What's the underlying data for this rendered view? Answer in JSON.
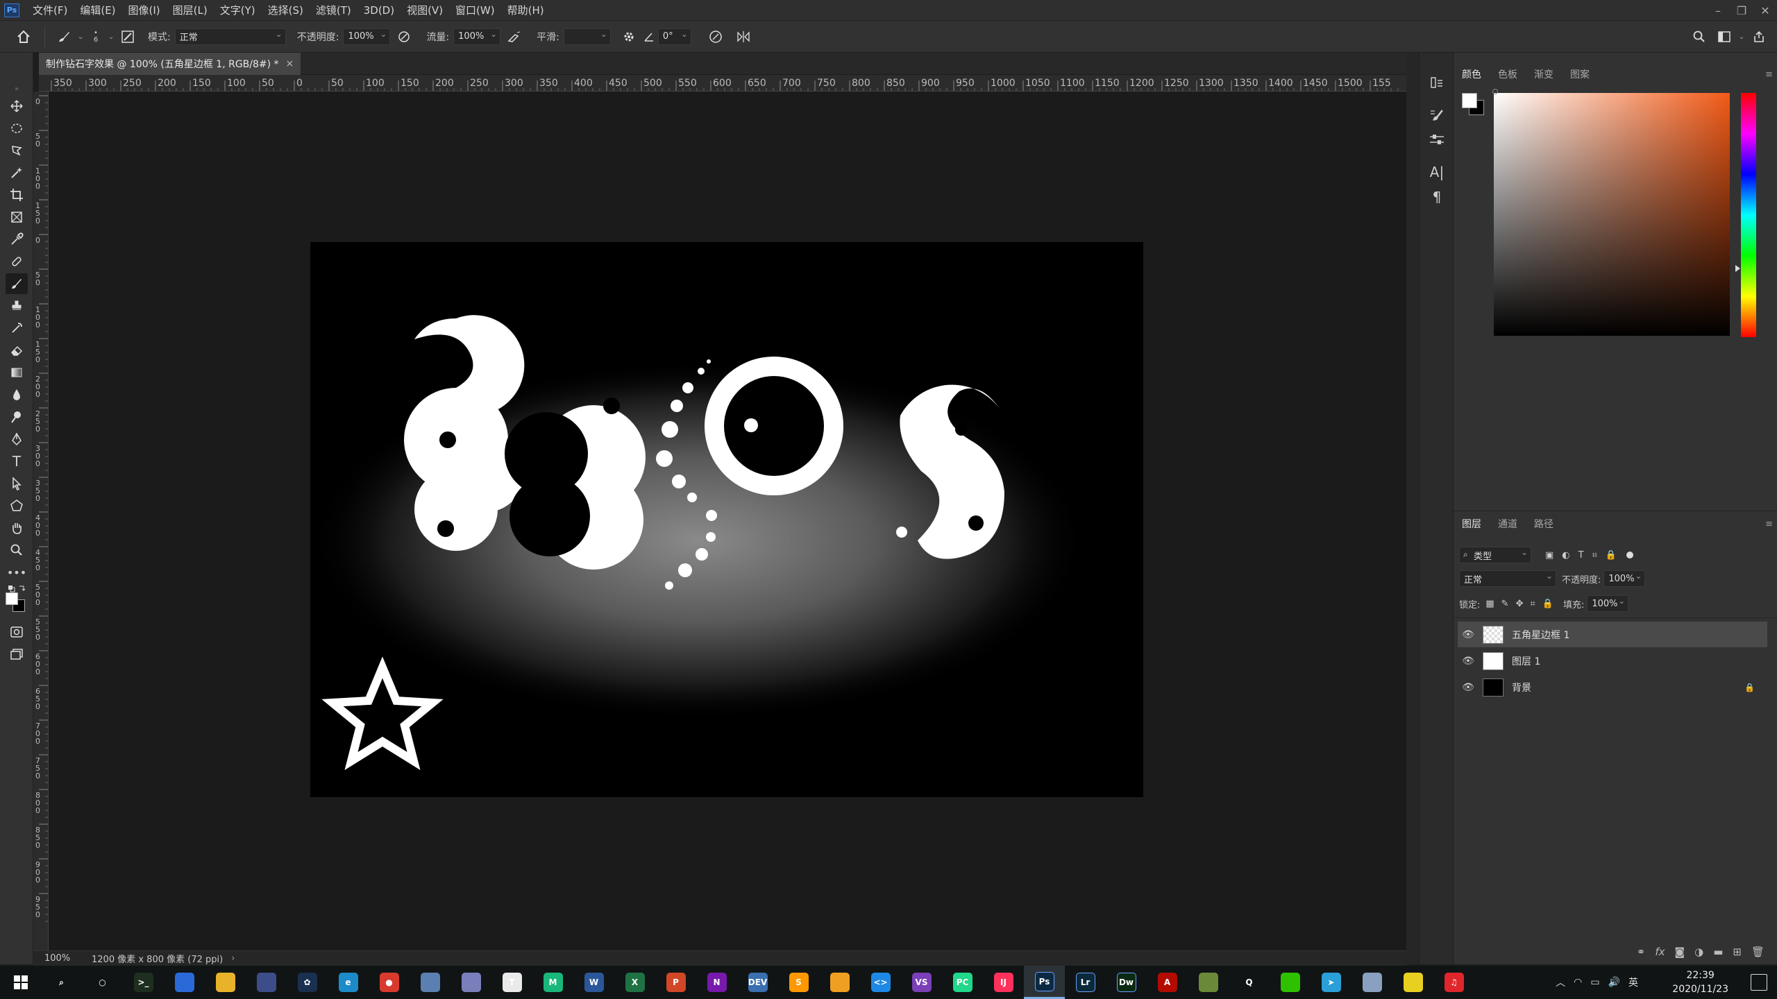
{
  "app": {
    "logo": "Ps"
  },
  "menu": [
    "文件(F)",
    "编辑(E)",
    "图像(I)",
    "图层(L)",
    "文字(Y)",
    "选择(S)",
    "滤镜(T)",
    "3D(D)",
    "视图(V)",
    "窗口(W)",
    "帮助(H)"
  ],
  "window_controls": [
    "–",
    "❐",
    "✕"
  ],
  "options": {
    "brush_size": "6",
    "mode_label": "模式:",
    "mode_value": "正常",
    "opacity_label": "不透明度:",
    "opacity_value": "100%",
    "flow_label": "流量:",
    "flow_value": "100%",
    "smooth_label": "平滑:",
    "smooth_value": "",
    "angle_value": "0°"
  },
  "document": {
    "tab_title": "制作钻石字效果 @ 100% (五角星边框 1, RGB/8#) *",
    "close": "×"
  },
  "ruler": {
    "h_labels": [
      "350",
      "300",
      "250",
      "200",
      "150",
      "100",
      "50",
      "0",
      "50",
      "100",
      "150",
      "200",
      "250",
      "300",
      "350",
      "400",
      "450",
      "500",
      "550",
      "600",
      "650",
      "700",
      "750",
      "800",
      "850",
      "900",
      "950",
      "1000",
      "1050",
      "1100",
      "1150",
      "1200",
      "1250",
      "1300",
      "1350",
      "1400",
      "1450",
      "1500",
      "155"
    ],
    "v_labels": [
      "0",
      "50",
      "100",
      "150",
      "0",
      "50",
      "100",
      "150",
      "200",
      "250",
      "300",
      "350",
      "400",
      "450",
      "500",
      "550",
      "600",
      "650",
      "700",
      "750",
      "800",
      "850",
      "900",
      "950"
    ]
  },
  "canvas": {
    "text": "2305",
    "bg": "#000000"
  },
  "status": {
    "zoom": "100%",
    "info": "1200 像素 x 800 像素 (72 ppi)",
    "arrow": "›"
  },
  "color_panel": {
    "tabs": [
      "颜色",
      "色板",
      "渐变",
      "图案"
    ],
    "fg": "#ffffff",
    "bg": "#000000",
    "hue_color": "#f25a17"
  },
  "layers_panel": {
    "tabs": [
      "图层",
      "通道",
      "路径"
    ],
    "filter_label": "类型",
    "blend_mode": "正常",
    "opacity_label": "不透明度:",
    "opacity_value": "100%",
    "lock_label": "锁定:",
    "fill_label": "填充:",
    "fill_value": "100%",
    "layers": [
      {
        "name": "五角星边框 1",
        "selected": true,
        "thumb": "#cccccc"
      },
      {
        "name": "图层 1",
        "selected": false,
        "thumb": "#ffffff"
      },
      {
        "name": "背景",
        "selected": false,
        "thumb": "#000000",
        "locked": true
      }
    ],
    "footer_icons": [
      "link-icon",
      "fx-icon",
      "mask-icon",
      "adjustment-icon",
      "folder-icon",
      "new-layer-icon",
      "trash-icon"
    ],
    "fx_label": "fx"
  },
  "taskbar": {
    "apps": [
      {
        "name": "search-icon",
        "label": "⌕",
        "color": "#101414"
      },
      {
        "name": "cortana-icon",
        "label": "○",
        "color": "#101414"
      },
      {
        "name": "terminal-icon",
        "label": ">_",
        "color": "#1f2f1f"
      },
      {
        "name": "app-icon-1",
        "label": "",
        "color": "#2a6ad8"
      },
      {
        "name": "file-explorer-icon",
        "label": "",
        "color": "#e8b32a"
      },
      {
        "name": "calculator-icon",
        "label": "",
        "color": "#3c4d8a"
      },
      {
        "name": "settings-icon",
        "label": "✿",
        "color": "#1a3050"
      },
      {
        "name": "edge-icon",
        "label": "e",
        "color": "#1d8ac9"
      },
      {
        "name": "chrome-icon",
        "label": "●",
        "color": "#d93a2e"
      },
      {
        "name": "app-icon-2",
        "label": "",
        "color": "#5a7fb0"
      },
      {
        "name": "app-icon-3",
        "label": "",
        "color": "#7a7fbc"
      },
      {
        "name": "typora-icon",
        "label": "T",
        "color": "#eaeaea"
      },
      {
        "name": "mindmaster-icon",
        "label": "M",
        "color": "#19b87a"
      },
      {
        "name": "word-icon",
        "label": "W",
        "color": "#2b579a"
      },
      {
        "name": "excel-icon",
        "label": "X",
        "color": "#1f7244"
      },
      {
        "name": "powerpoint-icon",
        "label": "P",
        "color": "#d24726"
      },
      {
        "name": "onenote-icon",
        "label": "N",
        "color": "#7719aa"
      },
      {
        "name": "devcpp-icon",
        "label": "DEV",
        "color": "#3a6fb0"
      },
      {
        "name": "sublime-icon",
        "label": "S",
        "color": "#ff9800"
      },
      {
        "name": "notes-icon",
        "label": "",
        "color": "#f0a020"
      },
      {
        "name": "vscode-icon",
        "label": "<>",
        "color": "#1e88e5"
      },
      {
        "name": "visualstudio-icon",
        "label": "VS",
        "color": "#7b3fb8"
      },
      {
        "name": "pycharm-icon",
        "label": "PC",
        "color": "#21d789"
      },
      {
        "name": "intellij-icon",
        "label": "IJ",
        "color": "#fe315d"
      },
      {
        "name": "photoshop-icon",
        "label": "Ps",
        "color": "#0a2a44"
      },
      {
        "name": "lightroom-icon",
        "label": "Lr",
        "color": "#0a2a3a"
      },
      {
        "name": "dreamweaver-icon",
        "label": "Dw",
        "color": "#0a2a14"
      },
      {
        "name": "acrobat-icon",
        "label": "A",
        "color": "#b30b00"
      },
      {
        "name": "app-icon-4",
        "label": "",
        "color": "#6a8a3a"
      },
      {
        "name": "qq-icon",
        "label": "Q",
        "color": "#101414"
      },
      {
        "name": "wechat-icon",
        "label": "",
        "color": "#2dc100"
      },
      {
        "name": "telegram-icon",
        "label": "➤",
        "color": "#2a9fd8"
      },
      {
        "name": "app-icon-5",
        "label": "",
        "color": "#8aa0c0"
      },
      {
        "name": "app-icon-6",
        "label": "",
        "color": "#e8d020"
      },
      {
        "name": "netease-music-icon",
        "label": "♫",
        "color": "#e0262b"
      }
    ],
    "tray": {
      "lang": "英",
      "time": "22:39",
      "date": "2020/11/23"
    }
  }
}
